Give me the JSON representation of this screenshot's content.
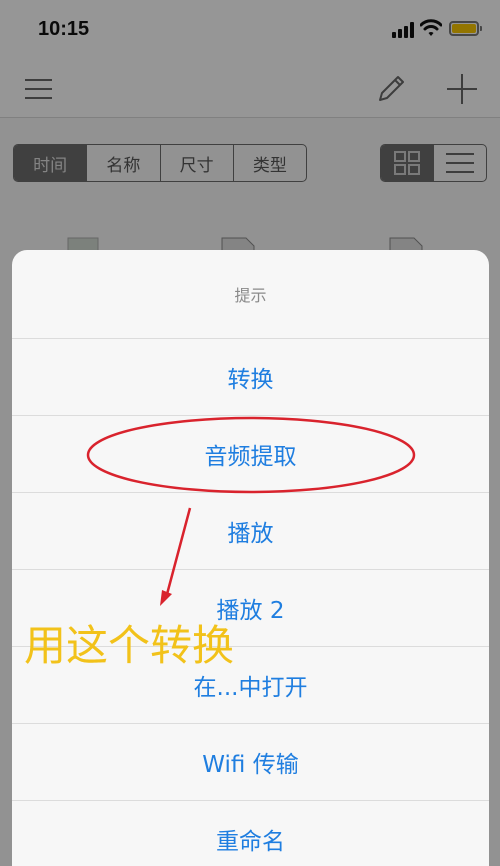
{
  "statusbar": {
    "time": "10:15"
  },
  "toolbar": {
    "sort_tabs": [
      {
        "label": "时间",
        "active": true
      },
      {
        "label": "名称",
        "active": false
      },
      {
        "label": "尺寸",
        "active": false
      },
      {
        "label": "类型",
        "active": false
      }
    ],
    "view_modes": [
      {
        "icon": "grid-icon",
        "active": true
      },
      {
        "icon": "list-icon",
        "active": false
      }
    ]
  },
  "navbar": {
    "left_icon": "menu-icon",
    "right_icons": [
      "edit-icon",
      "add-icon"
    ]
  },
  "sheet": {
    "title": "提示",
    "items": [
      {
        "label": "转换"
      },
      {
        "label": "音频提取"
      },
      {
        "label": "播放"
      },
      {
        "label": "播放 2"
      },
      {
        "label": "在...中打开"
      },
      {
        "label": "Wifi 传输"
      },
      {
        "label": "重命名"
      }
    ]
  },
  "annotation": {
    "text": "用这个转换",
    "ellipse_color": "#d9232d",
    "text_color": "#f2c21a"
  },
  "colors": {
    "accent": "#1f7ee0",
    "battery": "#f5c400"
  }
}
